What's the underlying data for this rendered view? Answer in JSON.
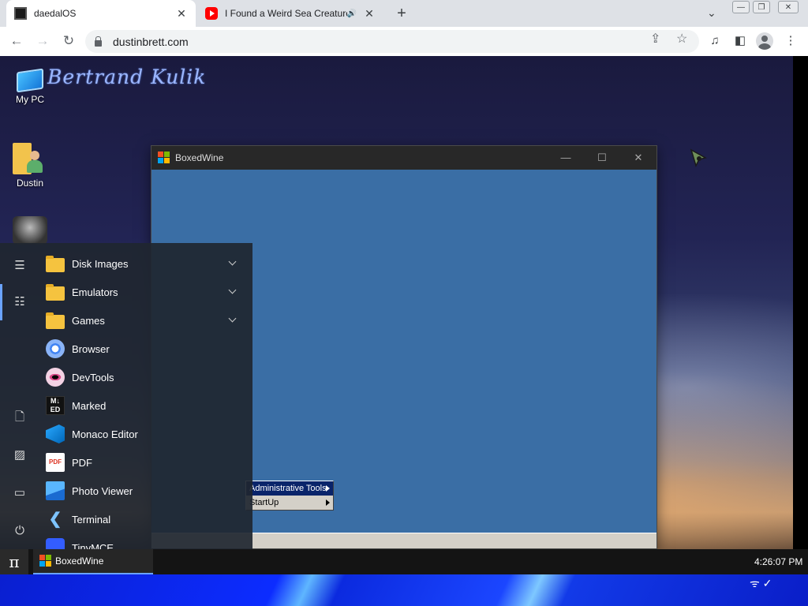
{
  "browser": {
    "tabs": [
      {
        "title": "daedalOS",
        "active": true
      },
      {
        "title": "I Found a Weird Sea Creature",
        "active": false,
        "audio": true
      }
    ],
    "url": "dustinbrett.com"
  },
  "desktop": {
    "signature": "Bertrand Kulik",
    "icons": [
      {
        "label": "My PC"
      },
      {
        "label": "Dustin"
      }
    ]
  },
  "window": {
    "title": "BoxedWine",
    "submenu": [
      {
        "label": "Administrative Tools",
        "selected": true
      },
      {
        "label": "StartUp",
        "selected": false
      }
    ]
  },
  "start_menu": {
    "items": [
      {
        "label": "Disk Images",
        "folder": true
      },
      {
        "label": "Emulators",
        "folder": true
      },
      {
        "label": "Games",
        "folder": true
      },
      {
        "label": "Browser"
      },
      {
        "label": "DevTools"
      },
      {
        "label": "Marked"
      },
      {
        "label": "Monaco Editor"
      },
      {
        "label": "PDF"
      },
      {
        "label": "Photo Viewer"
      },
      {
        "label": "Terminal"
      },
      {
        "label": "TinyMCE"
      }
    ],
    "icon_texts": {
      "marked": "M↓ ED",
      "pdf": "PDF"
    }
  },
  "taskbar": {
    "start_symbol": "π",
    "running": [
      {
        "label": "BoxedWine"
      }
    ],
    "clock": "4:26:07 PM"
  },
  "colors": {
    "wine_desktop": "#3a6ea5",
    "accent": "#6aa3ff",
    "menu_select": "#0a246a"
  }
}
